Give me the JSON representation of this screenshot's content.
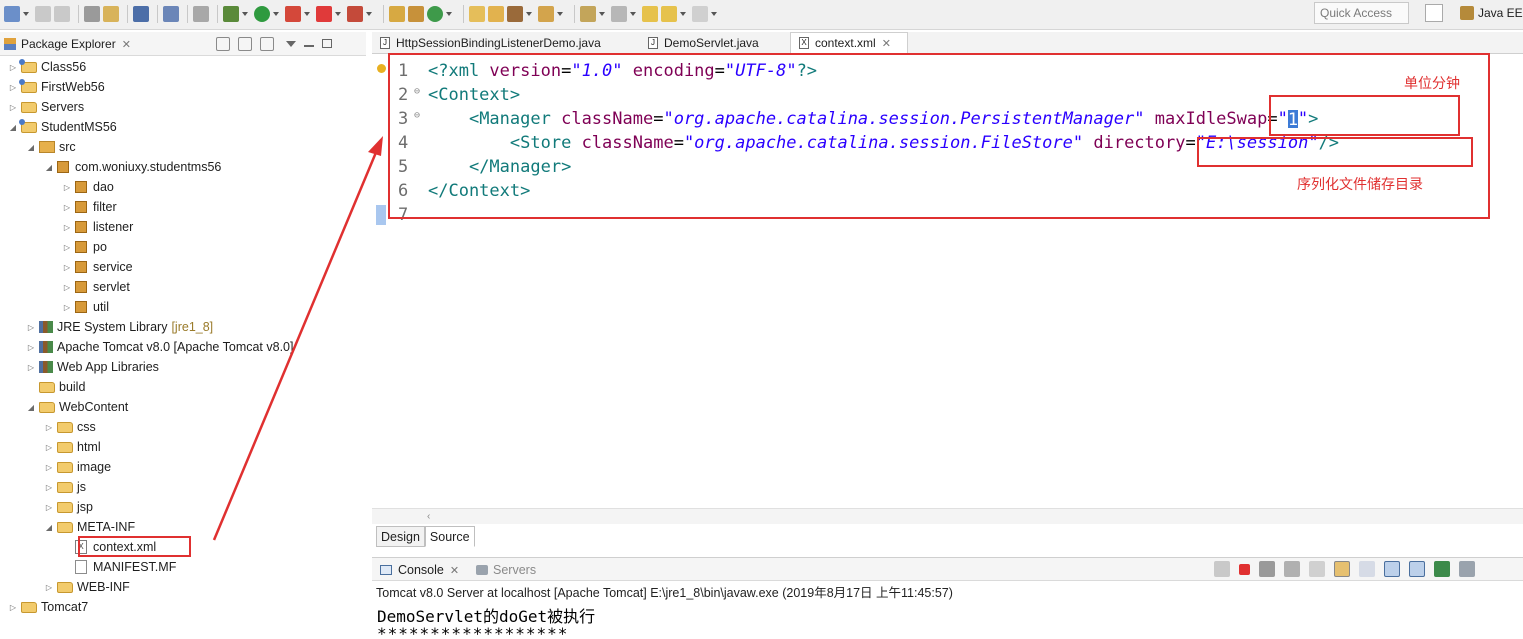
{
  "toolbar": {
    "quick_access_placeholder": "Quick Access",
    "perspective_label": "Java EE"
  },
  "package_explorer": {
    "title": "Package Explorer",
    "tree": [
      {
        "label": "Class56",
        "icon": "project-icon",
        "twisty": "▷"
      },
      {
        "label": "FirstWeb56",
        "icon": "project-icon",
        "twisty": "▷"
      },
      {
        "label": "Servers",
        "icon": "folder-icon",
        "twisty": "▷"
      },
      {
        "label": "StudentMS56",
        "icon": "project-icon",
        "twisty": "◢"
      },
      {
        "label": "src",
        "icon": "source-folder-icon",
        "twisty": "◢"
      },
      {
        "label": "com.woniuxy.studentms56",
        "icon": "package-icon",
        "twisty": "◢"
      },
      {
        "label": "dao",
        "icon": "package-icon",
        "twisty": "▷"
      },
      {
        "label": "filter",
        "icon": "package-icon",
        "twisty": "▷"
      },
      {
        "label": "listener",
        "icon": "package-icon",
        "twisty": "▷"
      },
      {
        "label": "po",
        "icon": "package-icon",
        "twisty": "▷"
      },
      {
        "label": "service",
        "icon": "package-icon",
        "twisty": "▷"
      },
      {
        "label": "servlet",
        "icon": "package-icon",
        "twisty": "▷"
      },
      {
        "label": "util",
        "icon": "package-icon",
        "twisty": "▷"
      },
      {
        "label": "JRE System Library",
        "suffix": "[jre1_8]",
        "icon": "library-icon",
        "twisty": "▷"
      },
      {
        "label": "Apache Tomcat v8.0 [Apache Tomcat v8.0]",
        "icon": "library-icon",
        "twisty": "▷"
      },
      {
        "label": "Web App Libraries",
        "icon": "library-icon",
        "twisty": "▷"
      },
      {
        "label": "build",
        "icon": "folder-icon",
        "twisty": ""
      },
      {
        "label": "WebContent",
        "icon": "folder-icon",
        "twisty": "◢"
      },
      {
        "label": "css",
        "icon": "folder-icon",
        "twisty": "▷"
      },
      {
        "label": "html",
        "icon": "folder-icon",
        "twisty": "▷"
      },
      {
        "label": "image",
        "icon": "folder-icon",
        "twisty": "▷"
      },
      {
        "label": "js",
        "icon": "folder-icon",
        "twisty": "▷"
      },
      {
        "label": "jsp",
        "icon": "folder-icon",
        "twisty": "▷"
      },
      {
        "label": "META-INF",
        "icon": "folder-icon",
        "twisty": "◢"
      },
      {
        "label": "context.xml",
        "icon": "xml-file-icon",
        "twisty": ""
      },
      {
        "label": "MANIFEST.MF",
        "icon": "file-icon",
        "twisty": ""
      },
      {
        "label": "WEB-INF",
        "icon": "folder-icon",
        "twisty": "▷"
      },
      {
        "label": "Tomcat7",
        "icon": "folder-icon",
        "twisty": "▷"
      }
    ]
  },
  "editor": {
    "tabs": [
      {
        "label": "HttpSessionBindingListenerDemo.java",
        "icon_text": "J"
      },
      {
        "label": "DemoServlet.java",
        "icon_text": "J"
      },
      {
        "label": "context.xml",
        "icon_text": "X"
      }
    ],
    "lines": {
      "l1": {
        "num": "1",
        "p1": "<?xml ",
        "a1": "version",
        "eq1": "=",
        "v1": "\"1.0\"",
        "sp": " ",
        "a2": "encoding",
        "eq2": "=",
        "v2": "\"UTF-8\"",
        "end": "?>"
      },
      "l2": {
        "num": "2",
        "tag": "<Context>"
      },
      "l3": {
        "num": "3",
        "indent": "    ",
        "tag": "<Manager",
        "sp": " ",
        "a1": "className",
        "eq1": "=",
        "v1": "\"org.apache.catalina.session.PersistentManager\"",
        "sp2": " ",
        "a2": "maxIdleSwap",
        "eq2": "=",
        "q1": "\"",
        "cursor": "1",
        "q2": "\"",
        "end": ">"
      },
      "l4": {
        "num": "4",
        "indent": "        ",
        "tag": "<Store",
        "sp": " ",
        "a1": "className",
        "eq1": "=",
        "v1": "\"org.apache.catalina.session.FileStore\"",
        "sp2": " ",
        "a2": "directory",
        "eq2": "=",
        "v2": "\"E:\\session\"",
        "end": "/>"
      },
      "l5": {
        "num": "5",
        "indent": "    ",
        "tag": "</Manager>"
      },
      "l6": {
        "num": "6",
        "tag": "</Context>"
      },
      "l7": {
        "num": "7"
      }
    },
    "annotations": {
      "unit": "单位分钟",
      "dir": "序列化文件储存目录"
    },
    "bottom_tabs": [
      "Design",
      "Source"
    ]
  },
  "console": {
    "tabs": [
      "Console",
      "Servers"
    ],
    "status": "Tomcat v8.0 Server at localhost [Apache Tomcat] E:\\jre1_8\\bin\\javaw.exe (2019年8月17日 上午11:45:57)",
    "output": [
      "DemoServlet的doGet被执行",
      "******************"
    ]
  },
  "colors": {
    "annotation_red": "#e03030",
    "xml_tag": "#117a7a",
    "xml_attr": "#7f0055",
    "xml_value": "#2a00ff"
  }
}
